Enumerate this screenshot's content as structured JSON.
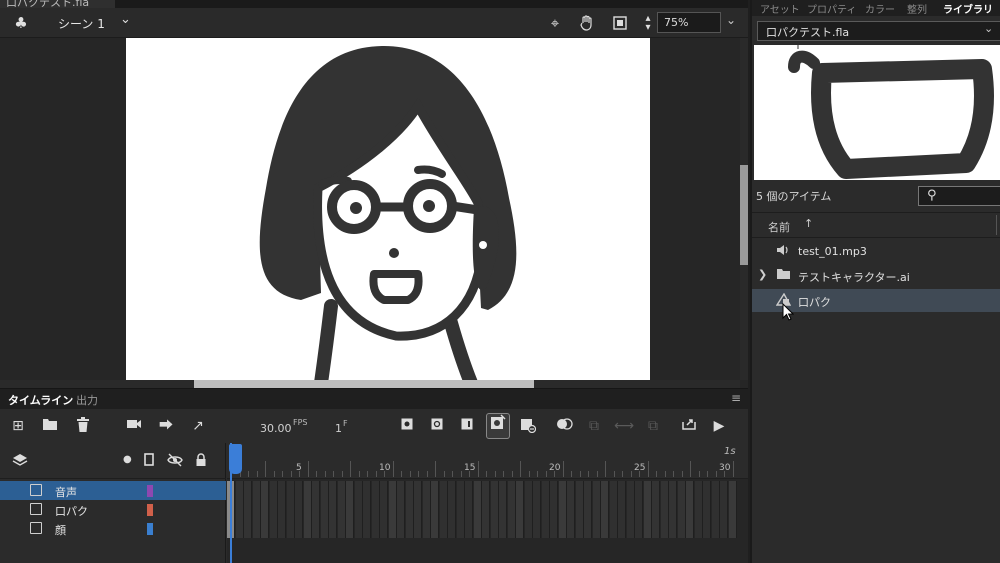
{
  "document": {
    "tab_title": "口パクテスト.fla"
  },
  "edit_bar": {
    "scene": "シーン 1",
    "zoom": "75%"
  },
  "timeline": {
    "tabs": [
      "タイムライン",
      "出力"
    ],
    "fps": "30.00",
    "fps_unit": "FPS",
    "frame": "1",
    "frame_unit": "F",
    "ruler": [
      "5",
      "10",
      "15",
      "20",
      "25",
      "30"
    ],
    "seconds_label": "1s",
    "layers": [
      {
        "name": "音声",
        "color": "#8e48b0",
        "selected": true
      },
      {
        "name": "口パク",
        "color": "#d0604a",
        "selected": false
      },
      {
        "name": "顔",
        "color": "#3a7fcf",
        "selected": false
      }
    ]
  },
  "right_panel": {
    "tabs": [
      "アセット",
      "プロパティ",
      "カラー",
      "整列",
      "ライブラリ"
    ],
    "active_tab": "ライブラリ",
    "document_select": "口パクテスト.fla",
    "item_count": "5 個のアイテム",
    "column_name": "名前",
    "sort_icon": "arrow-up-icon",
    "items": [
      {
        "name": "test_01.mp3",
        "icon": "speaker-icon",
        "expandable": false,
        "selected": false
      },
      {
        "name": "テストキャラクター.ai",
        "icon": "folder-icon",
        "expandable": true,
        "selected": false
      },
      {
        "name": "口パク",
        "icon": "graphic-symbol-icon",
        "expandable": false,
        "selected": true
      }
    ]
  },
  "colors": {
    "accent": "#3b7ed8",
    "selection": "#2c5f94",
    "canvas": "#ffffff",
    "ink": "#333333"
  }
}
